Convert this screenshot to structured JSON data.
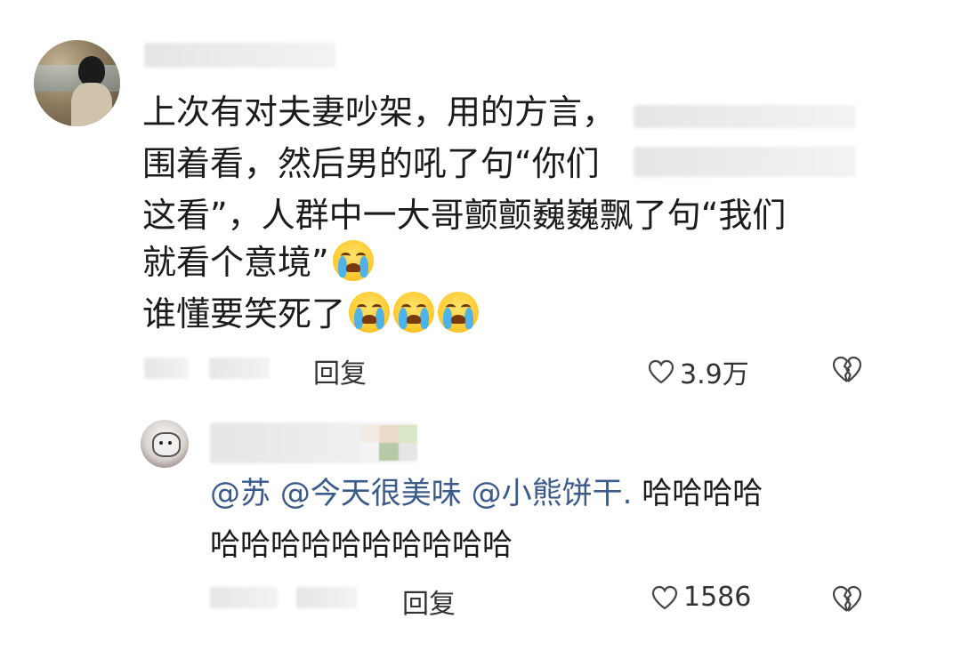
{
  "comment": {
    "lines": [
      "上次有对夫妻吵架，用的方言，",
      "围着看，然后男的吼了句“你们",
      "这看”，人群中一大哥颤颤巍巍飘了句“我们",
      "就看个意境”",
      "谁懂要笑死了"
    ],
    "reply_label": "回复",
    "like_count": "3.9万"
  },
  "reply": {
    "mention_1": "@苏",
    "mention_2": "@今天很美味",
    "mention_3": "@小熊饼干.",
    "text_line_1": "哈哈哈哈",
    "text_line_2": "哈哈哈哈哈哈哈哈哈哈",
    "reply_label": "回复",
    "like_count": "1586"
  },
  "icons": {
    "like": "heart-outline-icon",
    "dislike": "broken-heart-icon",
    "emoji": "loudly-crying-face-emoji"
  }
}
